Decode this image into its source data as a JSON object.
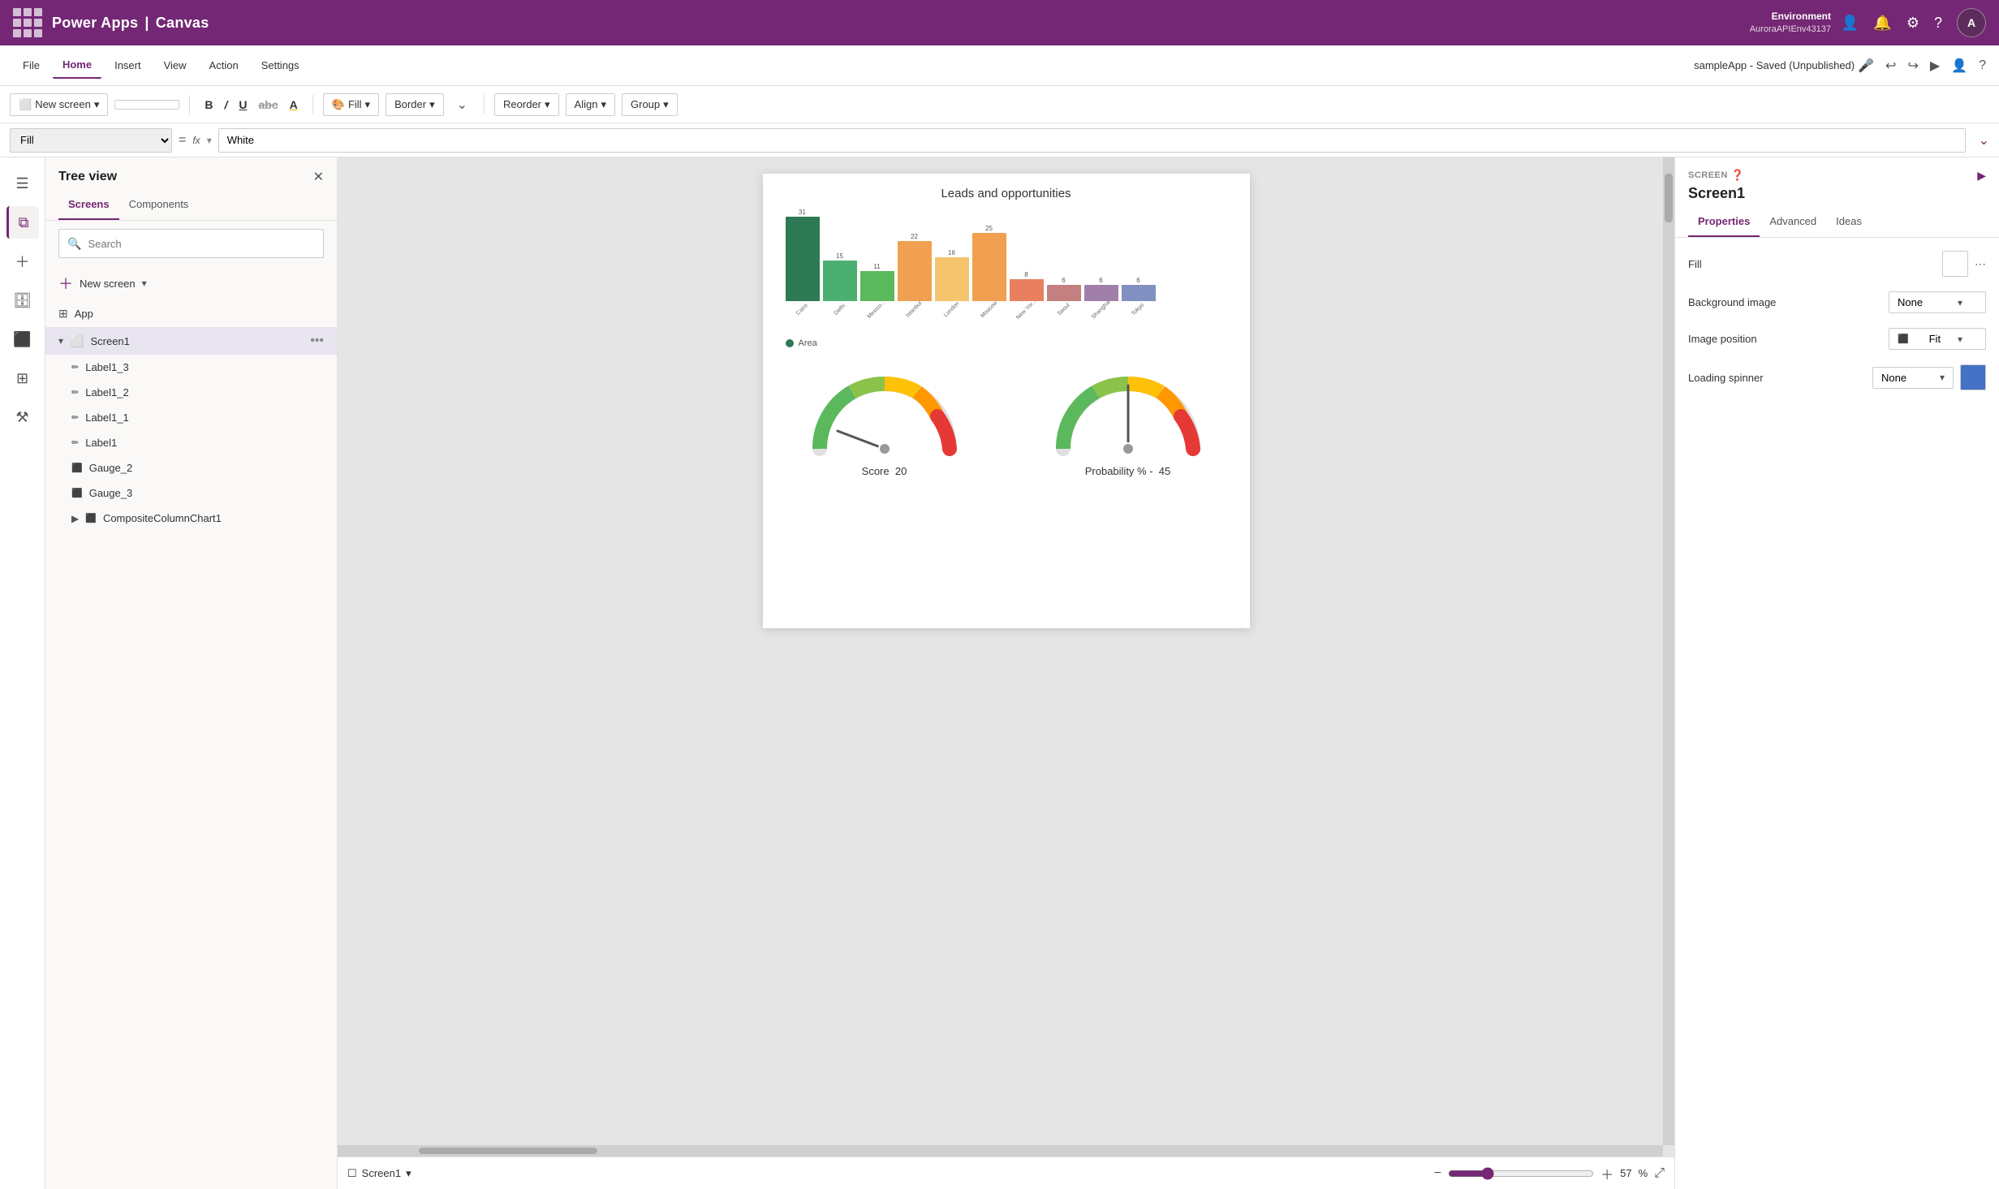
{
  "topbar": {
    "app_name": "Power Apps",
    "divider": "|",
    "canvas": "Canvas",
    "env_label": "Environment",
    "env_value": "AuroraAPIEnv43137",
    "avatar": "A"
  },
  "menubar": {
    "items": [
      "File",
      "Home",
      "Insert",
      "View",
      "Action",
      "Settings"
    ],
    "active": "Home",
    "app_saved": "sampleApp - Saved (Unpublished)"
  },
  "toolbar": {
    "new_screen": "New screen",
    "bold": "B",
    "italic": "/",
    "underline": "U",
    "strikethrough": "abc",
    "font_color": "A",
    "fill": "Fill",
    "border": "Border",
    "reorder": "Reorder",
    "align": "Align",
    "group": "Group"
  },
  "formulabar": {
    "property": "Fill",
    "fx": "fx",
    "value": "White"
  },
  "tree_view": {
    "title": "Tree view",
    "tabs": [
      "Screens",
      "Components"
    ],
    "active_tab": "Screens",
    "search_placeholder": "Search",
    "new_screen": "New screen",
    "items": [
      {
        "label": "App",
        "type": "app",
        "indent": 0
      },
      {
        "label": "Screen1",
        "type": "screen",
        "indent": 0,
        "selected": true,
        "expanded": true
      },
      {
        "label": "Label1_3",
        "type": "label",
        "indent": 1
      },
      {
        "label": "Label1_2",
        "type": "label",
        "indent": 1
      },
      {
        "label": "Label1_1",
        "type": "label",
        "indent": 1
      },
      {
        "label": "Label1",
        "type": "label",
        "indent": 1
      },
      {
        "label": "Gauge_2",
        "type": "gauge",
        "indent": 1
      },
      {
        "label": "Gauge_3",
        "type": "gauge",
        "indent": 1
      },
      {
        "label": "CompositeColumnChart1",
        "type": "chart",
        "indent": 1,
        "collapsed": true
      }
    ]
  },
  "canvas": {
    "chart_title": "Leads and opportunities",
    "bars": [
      {
        "label": "Cairo",
        "value": 31,
        "color": "#2d8659"
      },
      {
        "label": "Delhi",
        "value": 15,
        "color": "#3cb371"
      },
      {
        "label": "Mexico...",
        "value": 11,
        "color": "#5cb85c"
      },
      {
        "label": "Istanbul",
        "value": 22,
        "color": "#f0a050"
      },
      {
        "label": "London",
        "value": 16,
        "color": "#f5c56d"
      },
      {
        "label": "Moscow",
        "value": 25,
        "color": "#f0a050"
      },
      {
        "label": "New Yor...",
        "value": 8,
        "color": "#e88060"
      },
      {
        "label": "Seoul",
        "value": 6,
        "color": "#c88080"
      },
      {
        "label": "Shanghai",
        "value": 6,
        "color": "#a080a0"
      },
      {
        "label": "Tokyo",
        "value": 6,
        "color": "#8090c0"
      }
    ],
    "legend_label": "Area",
    "gauge1": {
      "label": "Score",
      "value": 20
    },
    "gauge2": {
      "label": "Probability % -",
      "value": 45
    },
    "screen_name": "Screen1",
    "zoom": 57,
    "zoom_unit": "%"
  },
  "right_panel": {
    "section_label": "SCREEN",
    "screen_name": "Screen1",
    "tabs": [
      "Properties",
      "Advanced",
      "Ideas"
    ],
    "active_tab": "Properties",
    "fill_label": "Fill",
    "bg_image_label": "Background image",
    "bg_image_value": "None",
    "image_position_label": "Image position",
    "image_position_value": "Fit",
    "loading_spinner_label": "Loading spinner",
    "loading_spinner_value": "None",
    "spinner_color": "#4472c4"
  }
}
